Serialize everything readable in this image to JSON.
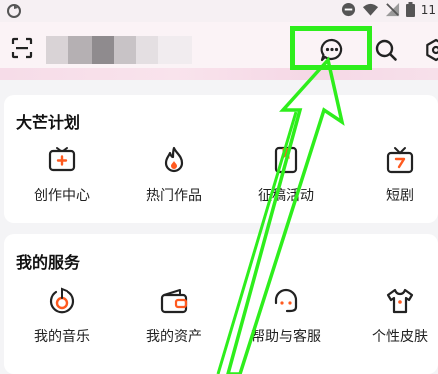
{
  "status_bar": {
    "clock": "11",
    "icons": [
      "sync-icon",
      "do-not-disturb-icon",
      "wifi-icon",
      "no-signal-icon",
      "battery-icon"
    ]
  },
  "header": {
    "icons": [
      "scan-icon",
      "message-icon",
      "search-icon",
      "settings-icon"
    ]
  },
  "section_plan": {
    "title": "大芒计划",
    "items": [
      {
        "label": "创作中心",
        "icon": "video-plus-icon"
      },
      {
        "label": "热门作品",
        "icon": "flame-icon"
      },
      {
        "label": "征稿活动",
        "icon": "bookmark-doc-icon"
      },
      {
        "label": "短剧",
        "icon": "tv-icon"
      }
    ]
  },
  "section_services": {
    "title": "我的服务",
    "items": [
      {
        "label": "我的音乐",
        "icon": "music-disc-icon"
      },
      {
        "label": "我的资产",
        "icon": "wallet-icon"
      },
      {
        "label": "帮助与客服",
        "icon": "headset-icon"
      },
      {
        "label": "个性皮肤",
        "icon": "tshirt-icon"
      }
    ]
  },
  "colors": {
    "accent": "#ff5a1f",
    "highlight": "#2eee1c",
    "header_bg": "#fbf3f6",
    "page_bg": "#f4f4f6"
  }
}
